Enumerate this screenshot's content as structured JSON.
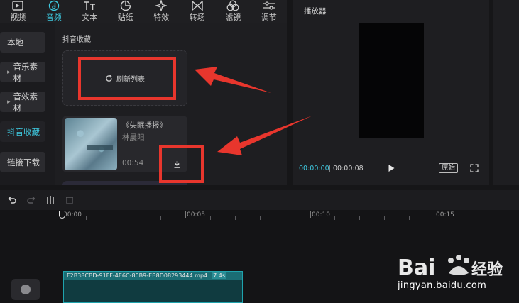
{
  "toolbar": {
    "items": [
      {
        "label": "视频",
        "icon": "video-icon"
      },
      {
        "label": "音频",
        "icon": "music-note-icon",
        "active": true
      },
      {
        "label": "文本",
        "icon": "text-icon"
      },
      {
        "label": "贴纸",
        "icon": "sticker-icon"
      },
      {
        "label": "特效",
        "icon": "sparkle-icon"
      },
      {
        "label": "转场",
        "icon": "transition-icon"
      },
      {
        "label": "滤镜",
        "icon": "filter-icon"
      },
      {
        "label": "调节",
        "icon": "adjust-icon"
      }
    ]
  },
  "sidebar": {
    "items": [
      {
        "label": "本地"
      },
      {
        "label": "音乐素材"
      },
      {
        "label": "音效素材"
      },
      {
        "label": "抖音收藏",
        "active": true
      },
      {
        "label": "链接下载"
      }
    ]
  },
  "collection": {
    "title": "抖音收藏",
    "refresh_label": "刷新列表",
    "song": {
      "title": "《失眠播报》",
      "artist": "林晨阳",
      "duration": "00:54"
    }
  },
  "player": {
    "title": "播放器",
    "current_time": "00:00:00",
    "separator": "|",
    "total_time": "00:00:08",
    "original_label": "原始"
  },
  "timeline": {
    "ruler": [
      "|00:00",
      "|00:05",
      "|00:10",
      "|00:15"
    ],
    "clip": {
      "name": "F2B38CBD-91FF-4E6C-80B9-EB8D08293444.mp4",
      "duration": "7.4s"
    }
  },
  "watermark": {
    "brand": "Bai du 经验",
    "url": "jingyan.baidu.com"
  },
  "colors": {
    "accent": "#3ec9e0",
    "annotation": "#e8362d",
    "clip": "#1b6d74"
  }
}
